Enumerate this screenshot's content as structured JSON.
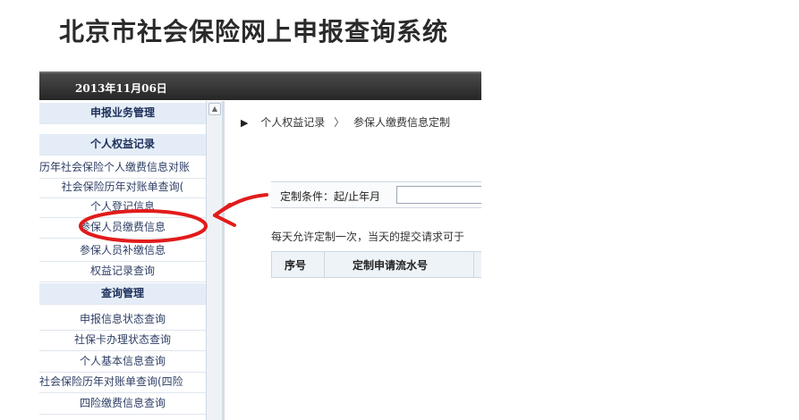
{
  "app": {
    "title": "北京市社会保险网上申报查询系统"
  },
  "header": {
    "date": "2013年11月06日"
  },
  "sidebar": {
    "items": [
      {
        "label": "申报业务管理",
        "type": "section"
      },
      {
        "label": "个人权益记录",
        "type": "section"
      },
      {
        "label": "历年社会保险个人缴费信息对账",
        "type": "link"
      },
      {
        "label": "社会保险历年对账单查询(",
        "type": "link"
      },
      {
        "label": "个人登记信息",
        "type": "link"
      },
      {
        "label": "参保人员缴费信息",
        "type": "link",
        "highlighted": true
      },
      {
        "label": "参保人员补缴信息",
        "type": "link"
      },
      {
        "label": "权益记录查询",
        "type": "link"
      },
      {
        "label": "查询管理",
        "type": "section"
      },
      {
        "label": "申报信息状态查询",
        "type": "link"
      },
      {
        "label": "社保卡办理状态查询",
        "type": "link"
      },
      {
        "label": "个人基本信息查询",
        "type": "link"
      },
      {
        "label": "社会保险历年对账单查询(四险",
        "type": "link"
      },
      {
        "label": "四险缴费信息查询",
        "type": "link"
      }
    ]
  },
  "breadcrumb": {
    "level1": "个人权益记录",
    "separator": "〉",
    "level2": "参保人缴费信息定制"
  },
  "filter": {
    "label": "定制条件：起/止年月",
    "value": ""
  },
  "notice": "每天允许定制一次，当天的提交请求可于",
  "table": {
    "headers": [
      "序号",
      "定制申请流水号"
    ]
  },
  "colors": {
    "annotation": "#e21b1b",
    "section_bg": "#e4edf7",
    "date_bar": "#333333"
  }
}
